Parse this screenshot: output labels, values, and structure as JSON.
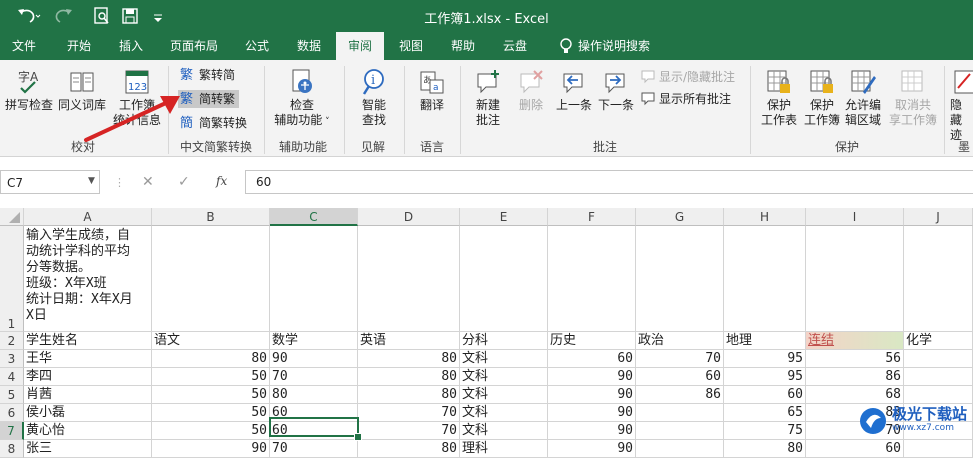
{
  "window": {
    "title": "工作簿1.xlsx  -  Excel"
  },
  "tabs": [
    {
      "label": "文件"
    },
    {
      "label": "开始"
    },
    {
      "label": "插入"
    },
    {
      "label": "页面布局"
    },
    {
      "label": "公式"
    },
    {
      "label": "数据"
    },
    {
      "label": "审阅"
    },
    {
      "label": "视图"
    },
    {
      "label": "帮助"
    },
    {
      "label": "云盘"
    },
    {
      "label": "操作说明搜索"
    }
  ],
  "ribbon": {
    "spell_check": "拼写检查",
    "thesaurus": "同义词库",
    "workbook_stats_1": "工作簿",
    "workbook_stats_2": "统计信息",
    "trad_to_simp": "繁转简",
    "simp_to_trad": "简转繁",
    "trad_simp_convert": "简繁转换",
    "check_access_1": "检查",
    "check_access_2": "辅助功能",
    "smart_lookup_1": "智能",
    "smart_lookup_2": "查找",
    "translate": "翻译",
    "new_comment_1": "新建",
    "new_comment_2": "批注",
    "delete": "删除",
    "previous": "上一条",
    "next": "下一条",
    "show_hide_comment": "显示/隐藏批注",
    "show_all_comments": "显示所有批注",
    "protect_sheet_1": "保护",
    "protect_sheet_2": "工作表",
    "protect_book_1": "保护",
    "protect_book_2": "工作簿",
    "allow_edit_1": "允许编",
    "allow_edit_2": "辑区域",
    "unshare_1": "取消共",
    "unshare_2": "享工作簿",
    "hide_ink_1": "隐藏",
    "hide_ink_2": "迹",
    "groups": {
      "proofing": "校对",
      "chinese_convert": "中文简繁转换",
      "accessibility": "辅助功能",
      "insights": "见解",
      "language": "语言",
      "comments": "批注",
      "protect": "保护",
      "ink": "墨"
    }
  },
  "formula_bar": {
    "name_box": "C7",
    "fx": "fx",
    "value": "60"
  },
  "columns": [
    "A",
    "B",
    "C",
    "D",
    "E",
    "F",
    "G",
    "H",
    "I",
    "J"
  ],
  "rows": [
    {
      "num": "1",
      "a": "输入学生成绩，自\n动统计学科的平均\n分等数据。\n班级：X年X班\n统计日期：X年X月\nX日"
    },
    {
      "num": "2",
      "cells": [
        "学生姓名",
        "语文",
        "数学",
        "英语",
        "分科",
        "历史",
        "政治",
        "地理",
        "连结",
        "化学"
      ]
    },
    {
      "num": "3",
      "cells": [
        "王华",
        "80",
        "90",
        "80",
        "文科",
        "60",
        "70",
        "95",
        "56",
        ""
      ]
    },
    {
      "num": "4",
      "cells": [
        "李四",
        "50",
        "70",
        "80",
        "文科",
        "90",
        "60",
        "95",
        "86",
        ""
      ]
    },
    {
      "num": "5",
      "cells": [
        "肖茜",
        "50",
        "80",
        "80",
        "文科",
        "90",
        "86",
        "60",
        "68",
        ""
      ]
    },
    {
      "num": "6",
      "cells": [
        "侯小磊",
        "50",
        "60",
        "70",
        "文科",
        "90",
        "",
        "65",
        "83",
        ""
      ]
    },
    {
      "num": "7",
      "cells": [
        "黄心怡",
        "50",
        "60",
        "70",
        "文科",
        "90",
        "",
        "75",
        "70",
        ""
      ]
    },
    {
      "num": "8",
      "cells": [
        "张三",
        "90",
        "70",
        "80",
        "理科",
        "90",
        "",
        "80",
        "60",
        ""
      ]
    }
  ],
  "watermark": {
    "text": "极光下载站",
    "url": "www.xz7.com"
  },
  "colors": {
    "excel_green": "#217346",
    "arrow_red": "#d62424"
  }
}
